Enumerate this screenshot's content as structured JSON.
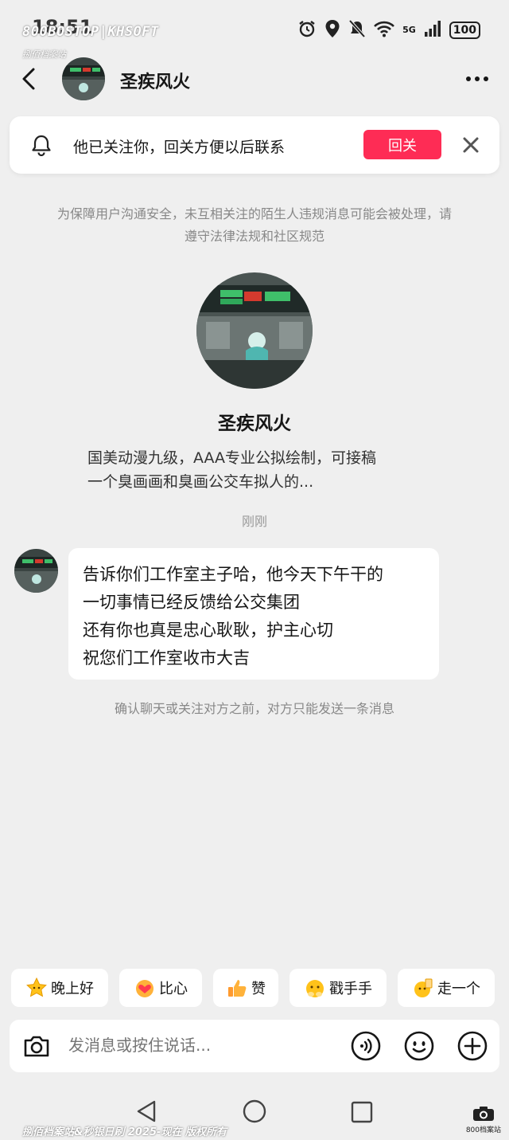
{
  "status_bar": {
    "time": "18:51",
    "watermark": "800BOSTOP|KHSOFT",
    "watermark_sub": "捌佰档案站",
    "network": "5G",
    "battery": "100"
  },
  "header": {
    "contact_name": "圣疾风火"
  },
  "banner": {
    "text": "他已关注你，回关方便以后联系",
    "follow_back_label": "回关"
  },
  "notice": "为保障用户沟通安全，未互相关注的陌生人违规消息可能会被处理，请遵守法律法规和社区规范",
  "profile": {
    "name": "圣疾风火",
    "bio_lines": [
      "国美动漫九级，AAA专业公拟绘制，可接稿",
      "一个臭画画和臭画公交车拟人的..."
    ]
  },
  "timestamp": "刚刚",
  "message": {
    "lines": [
      "告诉你们工作室主子哈，他今天下午干的",
      "一切事情已经反馈给公交集团",
      "还有你也真是忠心耿耿，护主心切",
      "祝您们工作室收市大吉"
    ]
  },
  "limit_notice": "确认聊天或关注对方之前，对方只能发送一条消息",
  "quick_replies": [
    {
      "label": "晚上好",
      "icon": "star-emoji-icon"
    },
    {
      "label": "比心",
      "icon": "heart-hands-emoji-icon"
    },
    {
      "label": "赞",
      "icon": "thumbs-up-emoji-icon"
    },
    {
      "label": "戳手手",
      "icon": "poke-emoji-icon"
    },
    {
      "label": "走一个",
      "icon": "cheers-emoji-icon"
    }
  ],
  "input": {
    "placeholder": "发消息或按住说话..."
  },
  "footer": {
    "watermark": "捌佰档案站&秒银日刷 2025-现在 版权所有",
    "logo_text": "800档案站"
  },
  "colors": {
    "accent": "#fe2c55",
    "background": "#efefef"
  }
}
